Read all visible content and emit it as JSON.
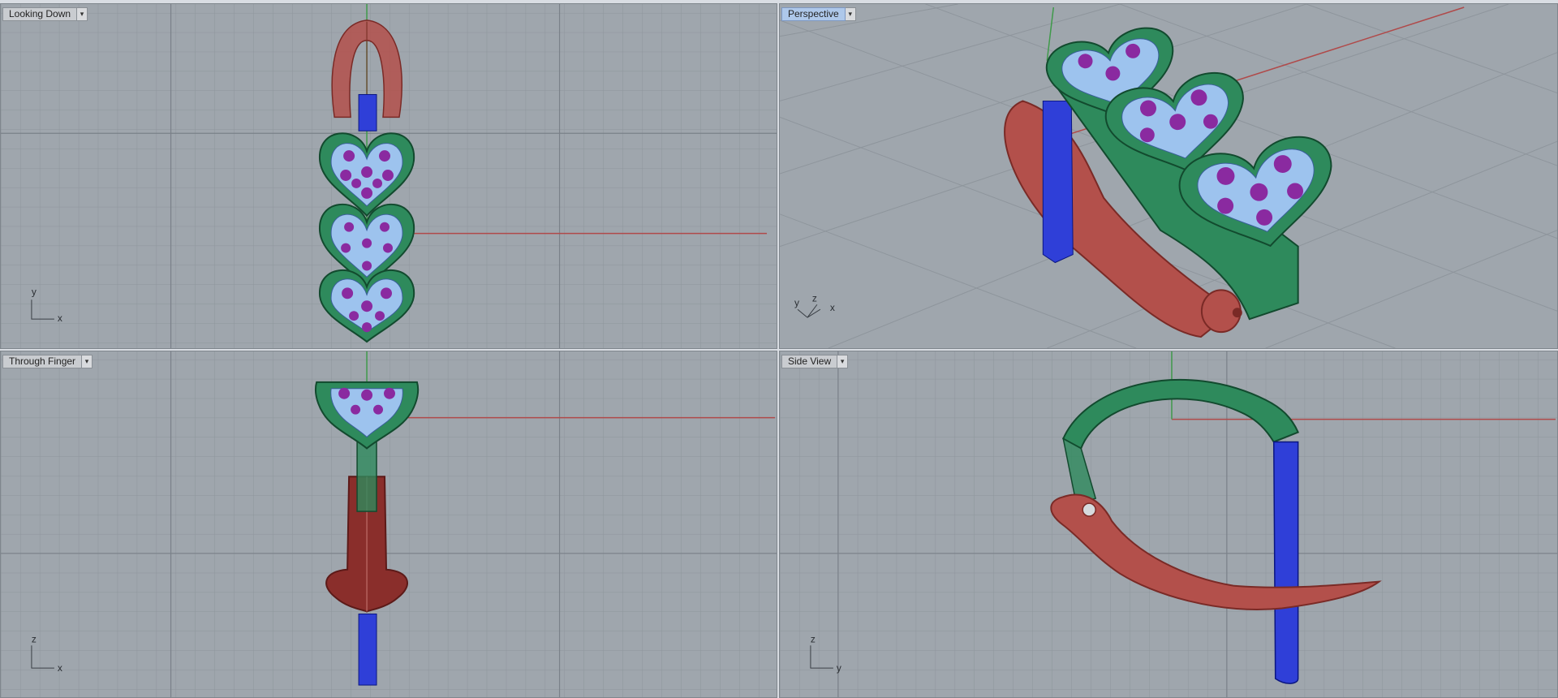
{
  "viewports": [
    {
      "title": "Looking Down",
      "axis_h": "x",
      "axis_v": "y",
      "active": false
    },
    {
      "title": "Perspective",
      "axis_h": "x",
      "axis_v": "z",
      "axis_d": "y",
      "active": true
    },
    {
      "title": "Through Finger",
      "axis_h": "x",
      "axis_v": "z",
      "active": false
    },
    {
      "title": "Side View",
      "axis_h": "y",
      "axis_v": "z",
      "active": false
    }
  ],
  "icons": {
    "dropdown": "chevron-down-icon"
  },
  "colors": {
    "viewport_bg": "#9fa6ad",
    "grid_minor": "#8e959c",
    "grid_major": "#7a8189",
    "x_axis": "#b04a4a",
    "y_axis": "#3f9a4a",
    "band_green": "#2e8a5c",
    "shank_red": "#b3504b",
    "stone_blue": "#9dc3ee",
    "gem_purple": "#8a2aa0",
    "blue_part": "#2f3fd8",
    "active_tab": "#aec8ea"
  }
}
